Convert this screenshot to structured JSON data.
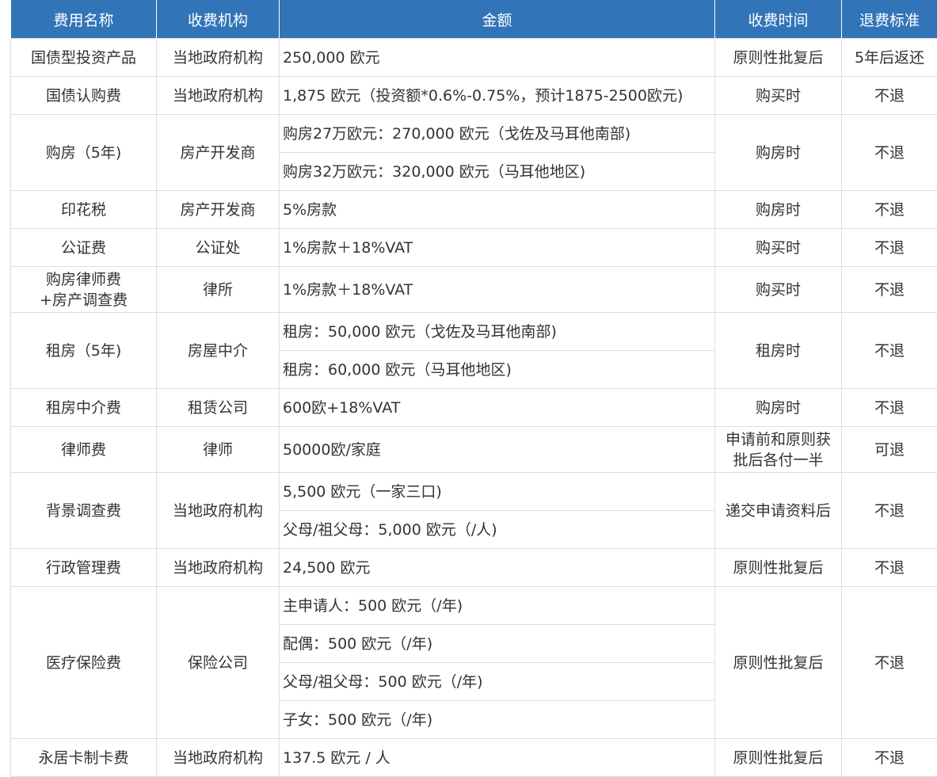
{
  "headers": [
    "费用名称",
    "收费机构",
    "金额",
    "收费时间",
    "退费标准"
  ],
  "rows": {
    "r1": {
      "name": "国债型投资产品",
      "agency": "当地政府机构",
      "amount": "250,000 欧元",
      "time": "原则性批复后",
      "refund": "5年后返还"
    },
    "r2": {
      "name": "国债认购费",
      "agency": "当地政府机构",
      "amount": "1,875 欧元（投资额*0.6%-0.75%，预计1875-2500欧元)",
      "time": "购买时",
      "refund": "不退"
    },
    "r3": {
      "name": "购房（5年)",
      "agency": "房产开发商",
      "amount1": "购房27万欧元：270,000 欧元（戈佐及马耳他南部)",
      "amount2": "购房32万欧元：320,000 欧元（马耳他地区)",
      "time": "购房时",
      "refund": "不退"
    },
    "r4": {
      "name": "印花税",
      "agency": "房产开发商",
      "amount": "5%房款",
      "time": "购房时",
      "refund": "不退"
    },
    "r5": {
      "name": "公证费",
      "agency": "公证处",
      "amount": "1%房款＋18%VAT",
      "time": "购买时",
      "refund": "不退"
    },
    "r6": {
      "name1": "购房律师费",
      "name2": "+房产调查费",
      "agency": "律所",
      "amount": "1%房款＋18%VAT",
      "time": "购买时",
      "refund": "不退"
    },
    "r7": {
      "name": "租房（5年)",
      "agency": "房屋中介",
      "amount1": "租房：50,000 欧元（戈佐及马耳他南部)",
      "amount2": "租房：60,000 欧元（马耳他地区)",
      "time": "租房时",
      "refund": "不退"
    },
    "r8": {
      "name": "租房中介费",
      "agency": "租赁公司",
      "amount": "600欧+18%VAT",
      "time": "购房时",
      "refund": "不退"
    },
    "r9": {
      "name": "律师费",
      "agency": "律师",
      "amount": "50000欧/家庭",
      "time1": "申请前和原则获",
      "time2": "批后各付一半",
      "refund": "可退"
    },
    "r10": {
      "name": "背景调查费",
      "agency": "当地政府机构",
      "amount1": "5,500 欧元（一家三口)",
      "amount2": "父母/祖父母：5,000 欧元（/人)",
      "time": "递交申请资料后",
      "refund": "不退"
    },
    "r11": {
      "name": "行政管理费",
      "agency": "当地政府机构",
      "amount": "24,500 欧元",
      "time": "原则性批复后",
      "refund": "不退"
    },
    "r12": {
      "name": "医疗保险费",
      "agency": "保险公司",
      "amount1": "主申请人：500 欧元（/年)",
      "amount2": "配偶：500 欧元（/年)",
      "amount3": "父母/祖父母：500 欧元（/年)",
      "amount4": "子女：500 欧元（/年)",
      "time": "原则性批复后",
      "refund": "不退"
    },
    "r13": {
      "name": "永居卡制卡费",
      "agency": "当地政府机构",
      "amount": "137.5 欧元 / 人",
      "time": "原则性批复后",
      "refund": "不退"
    }
  },
  "colors": {
    "header_bg": "#3274b8",
    "header_text": "#ffffff",
    "border": "#dddddd",
    "text": "#333333"
  }
}
